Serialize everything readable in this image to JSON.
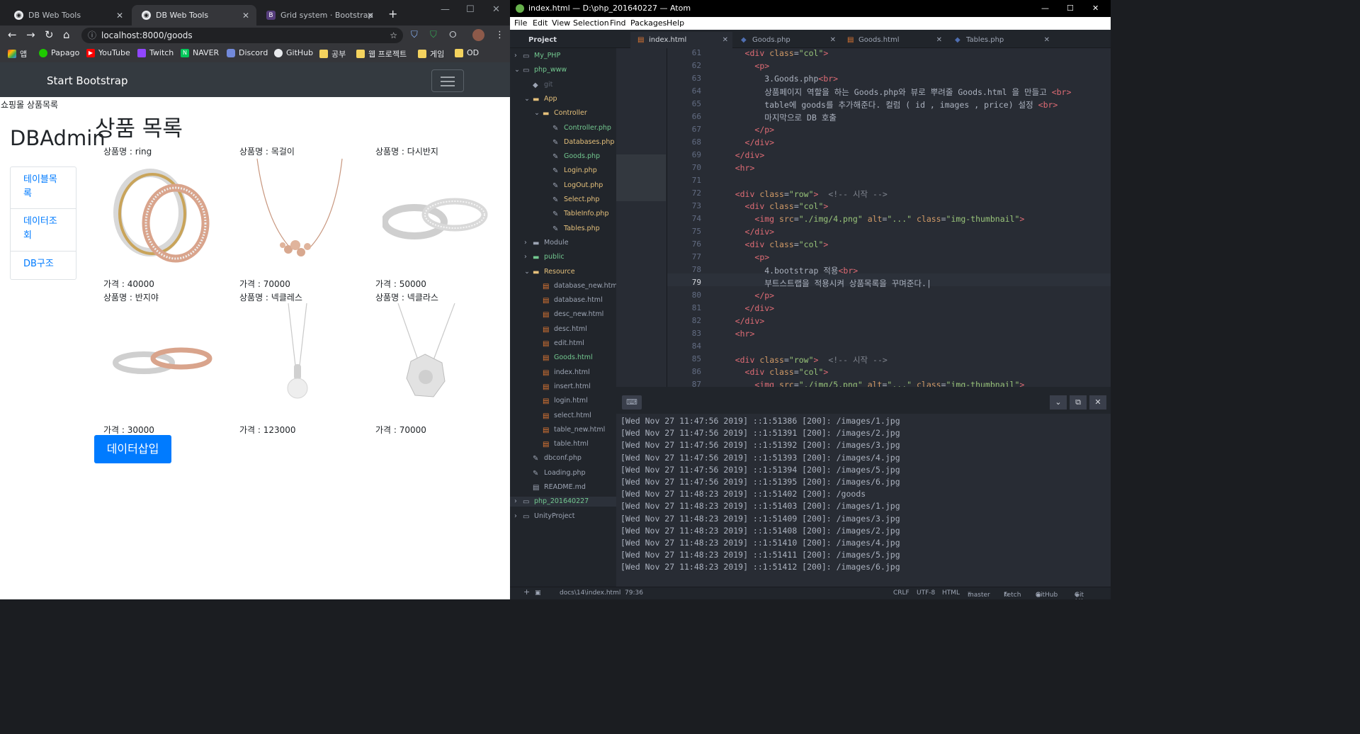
{
  "chrome": {
    "tabs": [
      {
        "title": "DB Web Tools"
      },
      {
        "title": "DB Web Tools"
      },
      {
        "title": "Grid system · Bootstrap"
      }
    ],
    "url": "localhost:8000/goods",
    "bookmarks": [
      "앱",
      "Papago",
      "YouTube",
      "Twitch",
      "NAVER",
      "Discord",
      "GitHub",
      "공부",
      "웹 프로젝트",
      "게임",
      "OD"
    ]
  },
  "page": {
    "brand": "Start Bootstrap",
    "header_text": "쇼핑몰 상품목록",
    "heading": "상품 목록",
    "sidebar_title": "DBAdmin",
    "sidebar_items": [
      "테이블목록",
      "데이터조회",
      "DB구조"
    ],
    "products": [
      {
        "name": "상품명 : ring",
        "price": "가격 : 40000"
      },
      {
        "name": "상품명 : 목걸이",
        "price": "가격 : 70000"
      },
      {
        "name": "상품명 : 다시반지",
        "price": "가격 : 50000"
      },
      {
        "name": "상품명 : 반지야",
        "price": "가격 : 30000"
      },
      {
        "name": "상품명 : 넥클레스",
        "price": "가격 : 123000"
      },
      {
        "name": "상품명 : 넥클라스",
        "price": "가격 : 70000"
      }
    ],
    "insert_button": "데이터삽입"
  },
  "atom": {
    "title": "index.html — D:\\php_201640227 — Atom",
    "menu": [
      "File",
      "Edit",
      "View",
      "Selection",
      "Find",
      "Packages",
      "Help"
    ],
    "tabs": [
      "Project",
      "index.html",
      "Goods.php",
      "Goods.html",
      "Tables.php"
    ],
    "tree": [
      {
        "label": "My_PHP",
        "depth": 0,
        "type": "repo",
        "color": "#73c990"
      },
      {
        "label": "php_www",
        "depth": 0,
        "type": "repo",
        "color": "#73c990"
      },
      {
        "label": "git",
        "depth": 1,
        "type": "git",
        "color": "#5c6370"
      },
      {
        "label": "App",
        "depth": 1,
        "type": "folder",
        "color": "#e5c07b"
      },
      {
        "label": "Controller",
        "depth": 2,
        "type": "folder",
        "color": "#e5c07b"
      },
      {
        "label": "Controller.php",
        "depth": 3,
        "type": "php",
        "color": "#73c990"
      },
      {
        "label": "Databases.php",
        "depth": 3,
        "type": "php",
        "color": "#e5c07b"
      },
      {
        "label": "Goods.php",
        "depth": 3,
        "type": "php",
        "color": "#73c990"
      },
      {
        "label": "Login.php",
        "depth": 3,
        "type": "php",
        "color": "#e5c07b"
      },
      {
        "label": "LogOut.php",
        "depth": 3,
        "type": "php",
        "color": "#e5c07b"
      },
      {
        "label": "Select.php",
        "depth": 3,
        "type": "php",
        "color": "#e5c07b"
      },
      {
        "label": "TableInfo.php",
        "depth": 3,
        "type": "php",
        "color": "#e5c07b"
      },
      {
        "label": "Tables.php",
        "depth": 3,
        "type": "php",
        "color": "#e5c07b"
      },
      {
        "label": "Module",
        "depth": 1,
        "type": "folder",
        "color": "#9da5b4"
      },
      {
        "label": "public",
        "depth": 1,
        "type": "folder",
        "color": "#73c990"
      },
      {
        "label": "Resource",
        "depth": 1,
        "type": "folder",
        "color": "#e5c07b"
      },
      {
        "label": "database_new.html",
        "depth": 2,
        "type": "html",
        "color": "#9da5b4"
      },
      {
        "label": "database.html",
        "depth": 2,
        "type": "html",
        "color": "#9da5b4"
      },
      {
        "label": "desc_new.html",
        "depth": 2,
        "type": "html",
        "color": "#9da5b4"
      },
      {
        "label": "desc.html",
        "depth": 2,
        "type": "html",
        "color": "#9da5b4"
      },
      {
        "label": "edit.html",
        "depth": 2,
        "type": "html",
        "color": "#9da5b4"
      },
      {
        "label": "Goods.html",
        "depth": 2,
        "type": "html",
        "color": "#73c990"
      },
      {
        "label": "index.html",
        "depth": 2,
        "type": "html",
        "color": "#9da5b4"
      },
      {
        "label": "insert.html",
        "depth": 2,
        "type": "html",
        "color": "#9da5b4"
      },
      {
        "label": "login.html",
        "depth": 2,
        "type": "html",
        "color": "#9da5b4"
      },
      {
        "label": "select.html",
        "depth": 2,
        "type": "html",
        "color": "#9da5b4"
      },
      {
        "label": "table_new.html",
        "depth": 2,
        "type": "html",
        "color": "#9da5b4"
      },
      {
        "label": "table.html",
        "depth": 2,
        "type": "html",
        "color": "#9da5b4"
      },
      {
        "label": "dbconf.php",
        "depth": 1,
        "type": "php",
        "color": "#9da5b4"
      },
      {
        "label": "Loading.php",
        "depth": 1,
        "type": "php",
        "color": "#9da5b4"
      },
      {
        "label": "README.md",
        "depth": 1,
        "type": "md",
        "color": "#9da5b4"
      },
      {
        "label": "php_201640227",
        "depth": 0,
        "type": "repo",
        "color": "#73c990"
      },
      {
        "label": "UnityProject",
        "depth": 0,
        "type": "repo",
        "color": "#9da5b4"
      }
    ],
    "code": [
      {
        "n": "61",
        "html": "      <span class='t'>&lt;div</span> <span class='a'>class</span>=<span class='s'>\"col\"</span><span class='t'>&gt;</span>"
      },
      {
        "n": "62",
        "html": "        <span class='t'>&lt;p&gt;</span>"
      },
      {
        "n": "63",
        "html": "          3.Goods.php<span class='t'>&lt;br&gt;</span>"
      },
      {
        "n": "64",
        "html": "          상품페이지 역할을 하는 Goods.php와 뷰로 뿌려줄 Goods.html 을 만들고 <span class='t'>&lt;br&gt;</span>"
      },
      {
        "n": "65",
        "html": "          table에 goods를 추가해준다. 컬럼 ( id , images , price) 설정 <span class='t'>&lt;br&gt;</span>"
      },
      {
        "n": "66",
        "html": "          마지막으로 DB 호출"
      },
      {
        "n": "67",
        "html": "        <span class='t'>&lt;/p&gt;</span>"
      },
      {
        "n": "68",
        "html": "      <span class='t'>&lt;/div&gt;</span>"
      },
      {
        "n": "69",
        "html": "    <span class='t'>&lt;/div&gt;</span>"
      },
      {
        "n": "70",
        "html": "    <span class='t'>&lt;hr&gt;</span>"
      },
      {
        "n": "71",
        "html": ""
      },
      {
        "n": "72",
        "html": "    <span class='t'>&lt;div</span> <span class='a'>class</span>=<span class='s'>\"row\"</span><span class='t'>&gt;</span>  <span class='c'>&lt;!-- 시작 --&gt;</span>"
      },
      {
        "n": "73",
        "html": "      <span class='t'>&lt;div</span> <span class='a'>class</span>=<span class='s'>\"col\"</span><span class='t'>&gt;</span>"
      },
      {
        "n": "74",
        "html": "        <span class='t'>&lt;img</span> <span class='a'>src</span>=<span class='s'>\"./img/4.png\"</span> <span class='a'>alt</span>=<span class='s'>\"...\"</span> <span class='a'>class</span>=<span class='s'>\"img-thumbnail\"</span><span class='t'>&gt;</span>"
      },
      {
        "n": "75",
        "html": "      <span class='t'>&lt;/div&gt;</span>"
      },
      {
        "n": "76",
        "html": "      <span class='t'>&lt;div</span> <span class='a'>class</span>=<span class='s'>\"col\"</span><span class='t'>&gt;</span>"
      },
      {
        "n": "77",
        "html": "        <span class='t'>&lt;p&gt;</span>"
      },
      {
        "n": "78",
        "html": "          4.bootstrap 적용<span class='t'>&lt;br&gt;</span>"
      },
      {
        "n": "79",
        "html": "          부트스트랩을 적용시켜 상품목록을 꾸며준다.|"
      },
      {
        "n": "80",
        "html": "        <span class='t'>&lt;/p&gt;</span>"
      },
      {
        "n": "81",
        "html": "      <span class='t'>&lt;/div&gt;</span>"
      },
      {
        "n": "82",
        "html": "    <span class='t'>&lt;/div&gt;</span>"
      },
      {
        "n": "83",
        "html": "    <span class='t'>&lt;hr&gt;</span>"
      },
      {
        "n": "84",
        "html": ""
      },
      {
        "n": "85",
        "html": "    <span class='t'>&lt;div</span> <span class='a'>class</span>=<span class='s'>\"row\"</span><span class='t'>&gt;</span>  <span class='c'>&lt;!-- 시작 --&gt;</span>"
      },
      {
        "n": "86",
        "html": "      <span class='t'>&lt;div</span> <span class='a'>class</span>=<span class='s'>\"col\"</span><span class='t'>&gt;</span>"
      },
      {
        "n": "87",
        "html": "        <span class='t'>&lt;img</span> <span class='a'>src</span>=<span class='s'>\"./img/5.png\"</span> <span class='a'>alt</span>=<span class='s'>\"...\"</span> <span class='a'>class</span>=<span class='s'>\"img-thumbnail\"</span><span class='t'>&gt;</span>"
      }
    ],
    "console": [
      "[Wed Nov 27 11:47:56 2019] ::1:51386 [200]: /images/1.jpg",
      "[Wed Nov 27 11:47:56 2019] ::1:51391 [200]: /images/2.jpg",
      "[Wed Nov 27 11:47:56 2019] ::1:51392 [200]: /images/3.jpg",
      "[Wed Nov 27 11:47:56 2019] ::1:51393 [200]: /images/4.jpg",
      "[Wed Nov 27 11:47:56 2019] ::1:51394 [200]: /images/5.jpg",
      "[Wed Nov 27 11:47:56 2019] ::1:51395 [200]: /images/6.jpg",
      "[Wed Nov 27 11:48:23 2019] ::1:51402 [200]: /goods",
      "[Wed Nov 27 11:48:23 2019] ::1:51403 [200]: /images/1.jpg",
      "[Wed Nov 27 11:48:23 2019] ::1:51409 [200]: /images/3.jpg",
      "[Wed Nov 27 11:48:23 2019] ::1:51408 [200]: /images/2.jpg",
      "[Wed Nov 27 11:48:23 2019] ::1:51410 [200]: /images/4.jpg",
      "[Wed Nov 27 11:48:23 2019] ::1:51411 [200]: /images/5.jpg",
      "[Wed Nov 27 11:48:23 2019] ::1:51412 [200]: /images/6.jpg"
    ],
    "status": {
      "path": "docs\\14\\index.html",
      "cursor": "79:36",
      "eol": "CRLF",
      "encoding": "UTF-8",
      "grammar": "HTML",
      "branch": "master",
      "fetch": "Fetch",
      "github": "GitHub",
      "git": "Git (4)"
    }
  }
}
